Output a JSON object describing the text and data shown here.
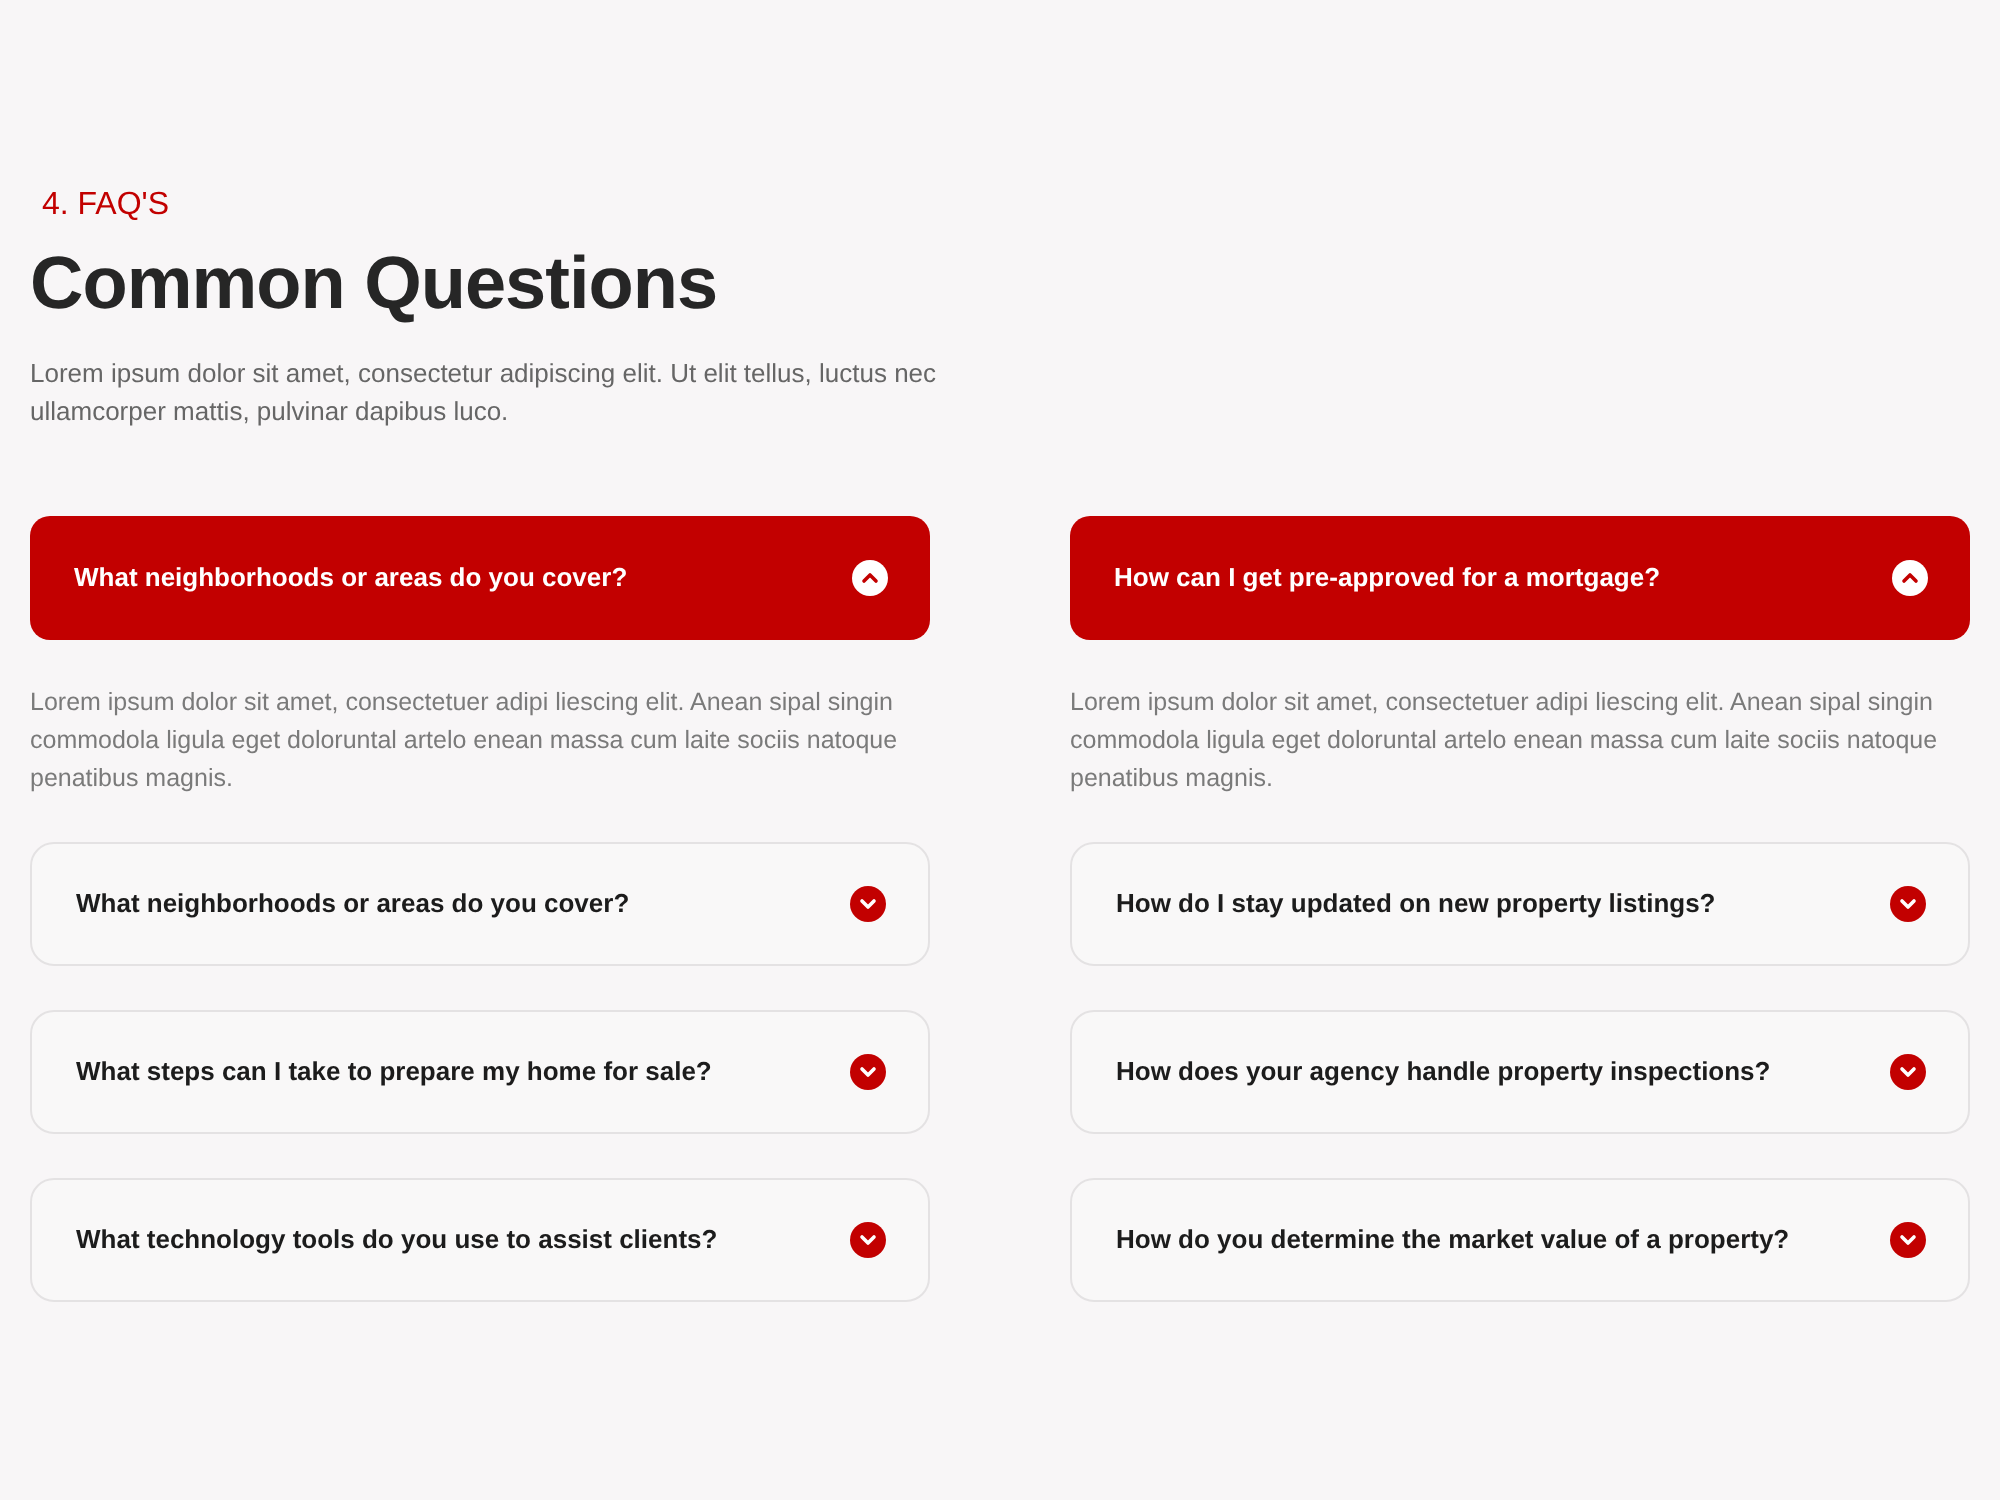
{
  "section": {
    "eyebrow": "4. FAQ'S",
    "title": "Common Questions",
    "description": "Lorem ipsum dolor sit amet, consectetur adipiscing elit. Ut elit tellus, luctus nec ullamcorper mattis, pulvinar dapibus luco."
  },
  "columns": [
    {
      "items": [
        {
          "question": "What neighborhoods or areas do you cover?",
          "expanded": true,
          "answer": "Lorem ipsum dolor sit amet, consectetuer adipi liescing elit. Anean sipal singin commodola ligula eget doloruntal artelo enean massa cum laite sociis natoque penatibus magnis."
        },
        {
          "question": "What neighborhoods or areas do you cover?",
          "expanded": false
        },
        {
          "question": "What steps can I take to prepare my home for sale?",
          "expanded": false
        },
        {
          "question": "What technology tools do you use to assist clients?",
          "expanded": false
        }
      ]
    },
    {
      "items": [
        {
          "question": "How can I get pre-approved for a mortgage?",
          "expanded": true,
          "answer": "Lorem ipsum dolor sit amet, consectetuer adipi liescing elit. Anean sipal singin commodola ligula eget doloruntal artelo enean massa cum laite sociis natoque penatibus magnis."
        },
        {
          "question": "How do I stay updated on new property listings?",
          "expanded": false
        },
        {
          "question": "How does your agency handle property inspections?",
          "expanded": false
        },
        {
          "question": "How do you determine the market value of a property?",
          "expanded": false
        }
      ]
    }
  ]
}
